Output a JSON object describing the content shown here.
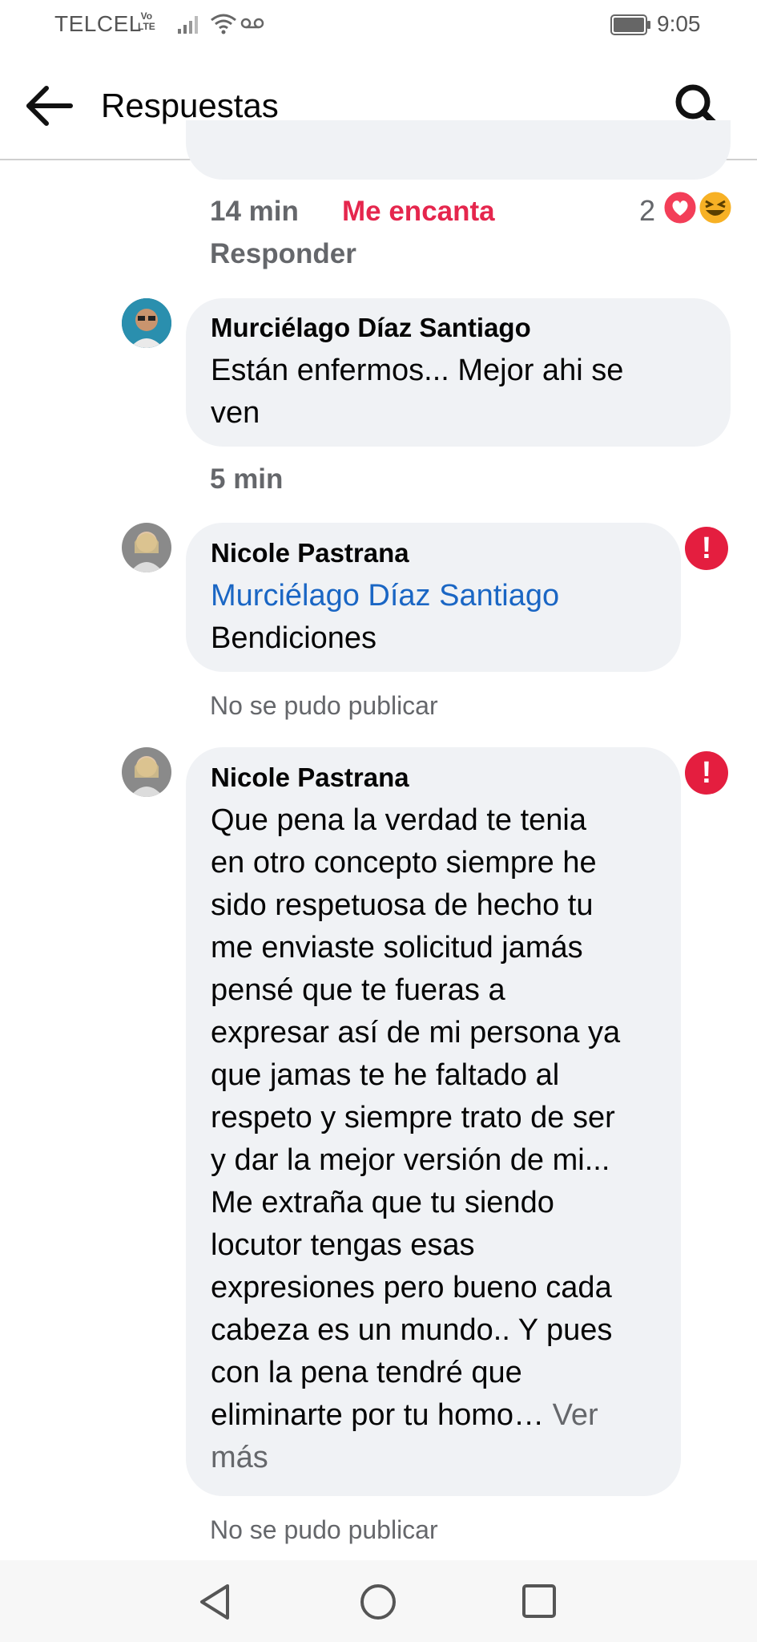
{
  "status_bar": {
    "carrier": "TELCEL",
    "volte": "Vo LTE",
    "time": "9:05"
  },
  "header": {
    "title": "Respuestas"
  },
  "prev_reply": {
    "time": "14 min",
    "reaction_label": "Me encanta",
    "reaction_count": "2",
    "reply_label": "Responder"
  },
  "comments": [
    {
      "author": "Murciélago Díaz Santiago",
      "text_lines": [
        "Están enfermos... Mejor ahi se",
        "ven"
      ],
      "time": "5 min"
    },
    {
      "author": "Nicole Pastrana",
      "mention": "Murciélago Díaz Santiago",
      "text": "Bendiciones",
      "status": "No se pudo publicar"
    },
    {
      "author": "Nicole Pastrana",
      "text_lines": [
        "Que pena la verdad te tenia",
        "en otro concepto siempre he",
        "sido respetuosa de hecho tu",
        "me enviaste solicitud jamás",
        "pensé que te fueras a",
        "expresar así de mi persona ya",
        "que jamas te he faltado al",
        "respeto y siempre trato de ser",
        "y dar la mejor versión de mi...",
        "Me extraña que tu siendo",
        "locutor tengas esas",
        "expresiones pero bueno cada",
        "cabeza es un mundo.. Y pues",
        "con la pena tendré que",
        "eliminarte por tu homo…"
      ],
      "see_more_a": "Ver",
      "see_more_b": "más",
      "status": "No se pudo publicar"
    }
  ]
}
